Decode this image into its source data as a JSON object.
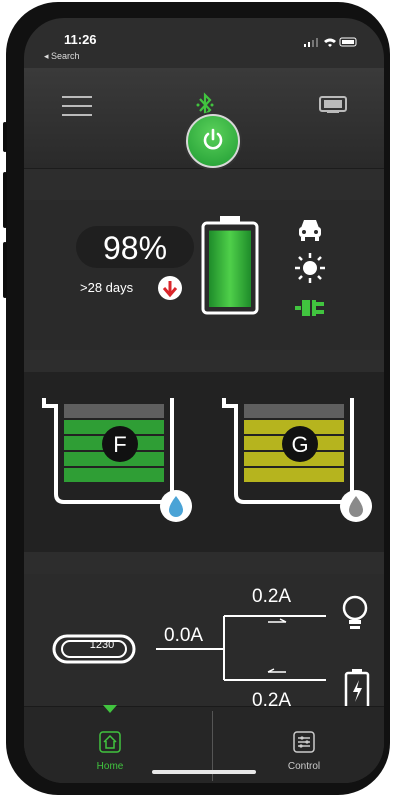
{
  "status": {
    "time": "11:26",
    "back_label": "◂ Search"
  },
  "battery": {
    "percent": "98%",
    "runtime": ">28 days",
    "level": 0.98
  },
  "tanks": [
    {
      "letter": "F",
      "color": "#2f9e35"
    },
    {
      "letter": "G",
      "color": "#b6b41e"
    }
  ],
  "circuit": {
    "input_label": "1230",
    "input_current": "0.0A",
    "top_current": "0.2A",
    "bottom_current": "0.2A"
  },
  "tabs": [
    {
      "label": "Home",
      "active": true
    },
    {
      "label": "Control",
      "active": false
    }
  ],
  "colors": {
    "accent": "#41c43f",
    "alert": "#d9262b"
  }
}
